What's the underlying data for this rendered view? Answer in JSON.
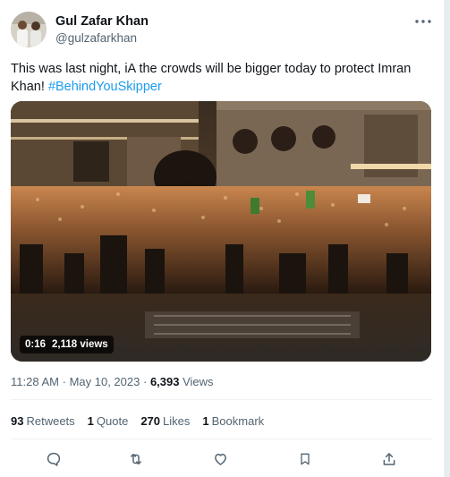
{
  "tweet": {
    "author": {
      "display_name": "Gul Zafar Khan",
      "handle": "@gulzafarkhan",
      "avatar_icon": "avatar"
    },
    "text_main": "This was last night, iA the crowds will be bigger today to protect Imran Khan!",
    "hashtag": "#BehindYouSkipper",
    "video": {
      "duration": "0:16",
      "views": "2,118 views"
    },
    "time": "11:28 AM",
    "date": "May 10, 2023",
    "view_count": "6,393",
    "views_label": "Views",
    "stats": {
      "retweets_count": "93",
      "retweets_label": "Retweets",
      "quotes_count": "1",
      "quotes_label": "Quote",
      "likes_count": "270",
      "likes_label": "Likes",
      "bookmarks_count": "1",
      "bookmarks_label": "Bookmark"
    },
    "actions": [
      "reply-icon",
      "retweet-icon",
      "like-icon",
      "bookmark-icon",
      "share-icon"
    ]
  },
  "colors": {
    "accent": "#1d9bf0",
    "text": "#0f1419",
    "muted": "#536471",
    "divider": "#eff3f4"
  }
}
